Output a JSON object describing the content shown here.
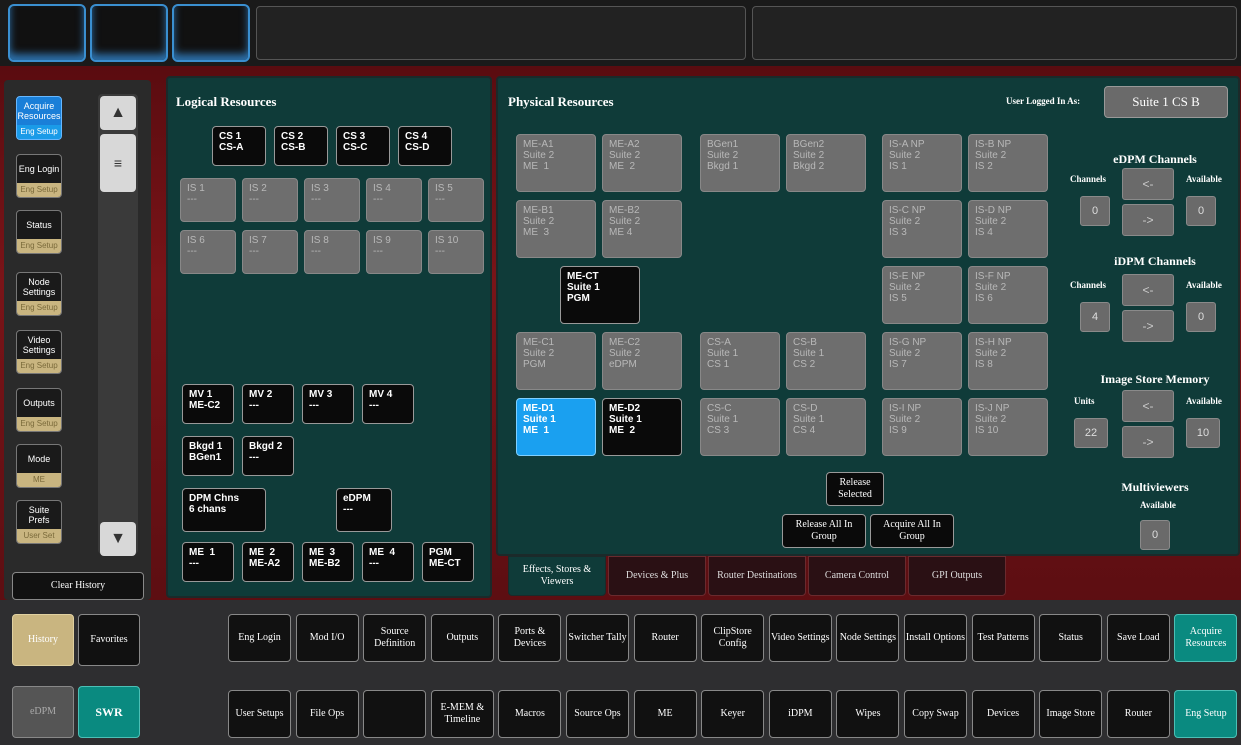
{
  "left_sidebar": {
    "items": [
      {
        "label": "Acquire Resources",
        "sub": "Eng Setup"
      },
      {
        "label": "Eng Login",
        "sub": "Eng Setup"
      },
      {
        "label": "Status",
        "sub": "Eng Setup"
      },
      {
        "label": "Node Settings",
        "sub": "Eng Setup"
      },
      {
        "label": "Video Settings",
        "sub": "Eng Setup"
      },
      {
        "label": "Outputs",
        "sub": "Eng Setup"
      },
      {
        "label": "Mode",
        "sub": "ME"
      },
      {
        "label": "Suite Prefs",
        "sub": "User Set"
      }
    ],
    "clear_history": "Clear History",
    "history": "History",
    "favorites": "Favorites",
    "edpm": "eDPM",
    "swr": "SWR"
  },
  "logical": {
    "title": "Logical Resources",
    "cs": [
      {
        "a": "CS 1",
        "b": "CS-A"
      },
      {
        "a": "CS 2",
        "b": "CS-B"
      },
      {
        "a": "CS 3",
        "b": "CS-C"
      },
      {
        "a": "CS 4",
        "b": "CS-D"
      }
    ],
    "is_row1": [
      {
        "a": "IS 1",
        "b": "---"
      },
      {
        "a": "IS 2",
        "b": "---"
      },
      {
        "a": "IS 3",
        "b": "---"
      },
      {
        "a": "IS 4",
        "b": "---"
      },
      {
        "a": "IS 5",
        "b": "---"
      }
    ],
    "is_row2": [
      {
        "a": "IS 6",
        "b": "---"
      },
      {
        "a": "IS 7",
        "b": "---"
      },
      {
        "a": "IS 8",
        "b": "---"
      },
      {
        "a": "IS 9",
        "b": "---"
      },
      {
        "a": "IS 10",
        "b": "---"
      }
    ],
    "mv": [
      {
        "a": "MV 1",
        "b": "ME-C2"
      },
      {
        "a": "MV 2",
        "b": "---"
      },
      {
        "a": "MV 3",
        "b": "---"
      },
      {
        "a": "MV 4",
        "b": "---"
      }
    ],
    "bkgd": [
      {
        "a": "Bkgd 1",
        "b": "BGen1"
      },
      {
        "a": "Bkgd 2",
        "b": "---"
      }
    ],
    "dpm": {
      "a": "DPM Chns",
      "b": "6 chans"
    },
    "edpm": {
      "a": "eDPM",
      "b": "---"
    },
    "me": [
      {
        "a": "ME  1",
        "b": "---"
      },
      {
        "a": "ME  2",
        "b": "ME-A2"
      },
      {
        "a": "ME  3",
        "b": "ME-B2"
      },
      {
        "a": "ME  4",
        "b": "---"
      },
      {
        "a": "PGM",
        "b": "ME-CT"
      }
    ]
  },
  "physical": {
    "title": "Physical Resources",
    "user_logged_label": "User Logged In As:",
    "user_logged_value": "Suite 1  CS B",
    "me_a": [
      {
        "a": "ME-A1",
        "b": "Suite 2",
        "c": "ME  1"
      },
      {
        "a": "ME-A2",
        "b": "Suite 2",
        "c": "ME  2"
      }
    ],
    "bgen": [
      {
        "a": "BGen1",
        "b": "Suite 2",
        "c": "Bkgd 1"
      },
      {
        "a": "BGen2",
        "b": "Suite 2",
        "c": "Bkgd 2"
      }
    ],
    "me_b": [
      {
        "a": "ME-B1",
        "b": "Suite 2",
        "c": "ME  3"
      },
      {
        "a": "ME-B2",
        "b": "Suite 2",
        "c": "ME 4"
      }
    ],
    "me_ct": {
      "a": "ME-CT",
      "b": "Suite 1",
      "c": "PGM"
    },
    "me_c": [
      {
        "a": "ME-C1",
        "b": "Suite 2",
        "c": "PGM"
      },
      {
        "a": "ME-C2",
        "b": "Suite 2",
        "c": "eDPM"
      }
    ],
    "cs_ab": [
      {
        "a": "CS-A",
        "b": "Suite 1",
        "c": "CS 1"
      },
      {
        "a": "CS-B",
        "b": "Suite 1",
        "c": "CS 2"
      }
    ],
    "me_d": [
      {
        "a": "ME-D1",
        "b": "Suite 1",
        "c": "ME  1"
      },
      {
        "a": "ME-D2",
        "b": "Suite 1",
        "c": "ME  2"
      }
    ],
    "cs_cd": [
      {
        "a": "CS-C",
        "b": "Suite 1",
        "c": "CS 3"
      },
      {
        "a": "CS-D",
        "b": "Suite 1",
        "c": "CS 4"
      }
    ],
    "is_np": [
      [
        {
          "a": "IS-A NP",
          "b": "Suite 2",
          "c": "IS 1"
        },
        {
          "a": "IS-B NP",
          "b": "Suite 2",
          "c": "IS 2"
        }
      ],
      [
        {
          "a": "IS-C NP",
          "b": "Suite 2",
          "c": "IS 3"
        },
        {
          "a": "IS-D NP",
          "b": "Suite 2",
          "c": "IS 4"
        }
      ],
      [
        {
          "a": "IS-E NP",
          "b": "Suite 2",
          "c": "IS 5"
        },
        {
          "a": "IS-F NP",
          "b": "Suite 2",
          "c": "IS 6"
        }
      ],
      [
        {
          "a": "IS-G NP",
          "b": "Suite 2",
          "c": "IS 7"
        },
        {
          "a": "IS-H NP",
          "b": "Suite 2",
          "c": "IS 8"
        }
      ],
      [
        {
          "a": "IS-I NP",
          "b": "Suite 2",
          "c": "IS 9"
        },
        {
          "a": "IS-J NP",
          "b": "Suite 2",
          "c": "IS 10"
        }
      ]
    ],
    "release_selected": "Release Selected",
    "release_all": "Release All In Group",
    "acquire_all": "Acquire All In Group"
  },
  "right": {
    "edpm": {
      "title": "eDPM Channels",
      "left_label": "Channels",
      "right_label": "Available",
      "left_value": "0",
      "right_value": "0"
    },
    "idpm": {
      "title": "iDPM Channels",
      "left_label": "Channels",
      "right_label": "Available",
      "left_value": "4",
      "right_value": "0"
    },
    "ism": {
      "title": "Image Store Memory",
      "left_label": "Units",
      "right_label": "Available",
      "left_value": "22",
      "right_value": "10"
    },
    "mv": {
      "title": "Multiviewers",
      "label": "Available",
      "value": "0"
    },
    "arrow_left": "<-",
    "arrow_right": "->"
  },
  "tabs": [
    "Effects, Stores & Viewers",
    "Devices & Plus",
    "Router Destinations",
    "Camera Control",
    "GPI Outputs"
  ],
  "menu_row1": [
    "Eng Login",
    "Mod I/O",
    "Source Definition",
    "Outputs",
    "Ports & Devices",
    "Switcher Tally",
    "Router",
    "ClipStore Config",
    "Video Settings",
    "Node Settings",
    "Install Options",
    "Test Patterns",
    "Status",
    "Save Load",
    "Acquire Resources"
  ],
  "menu_row2": [
    "User Setups",
    "File Ops",
    "",
    "E-MEM & Timeline",
    "Macros",
    "Source Ops",
    "ME",
    "Keyer",
    "iDPM",
    "Wipes",
    "Copy Swap",
    "Devices",
    "Image Store",
    "Router",
    "Eng Setup"
  ]
}
